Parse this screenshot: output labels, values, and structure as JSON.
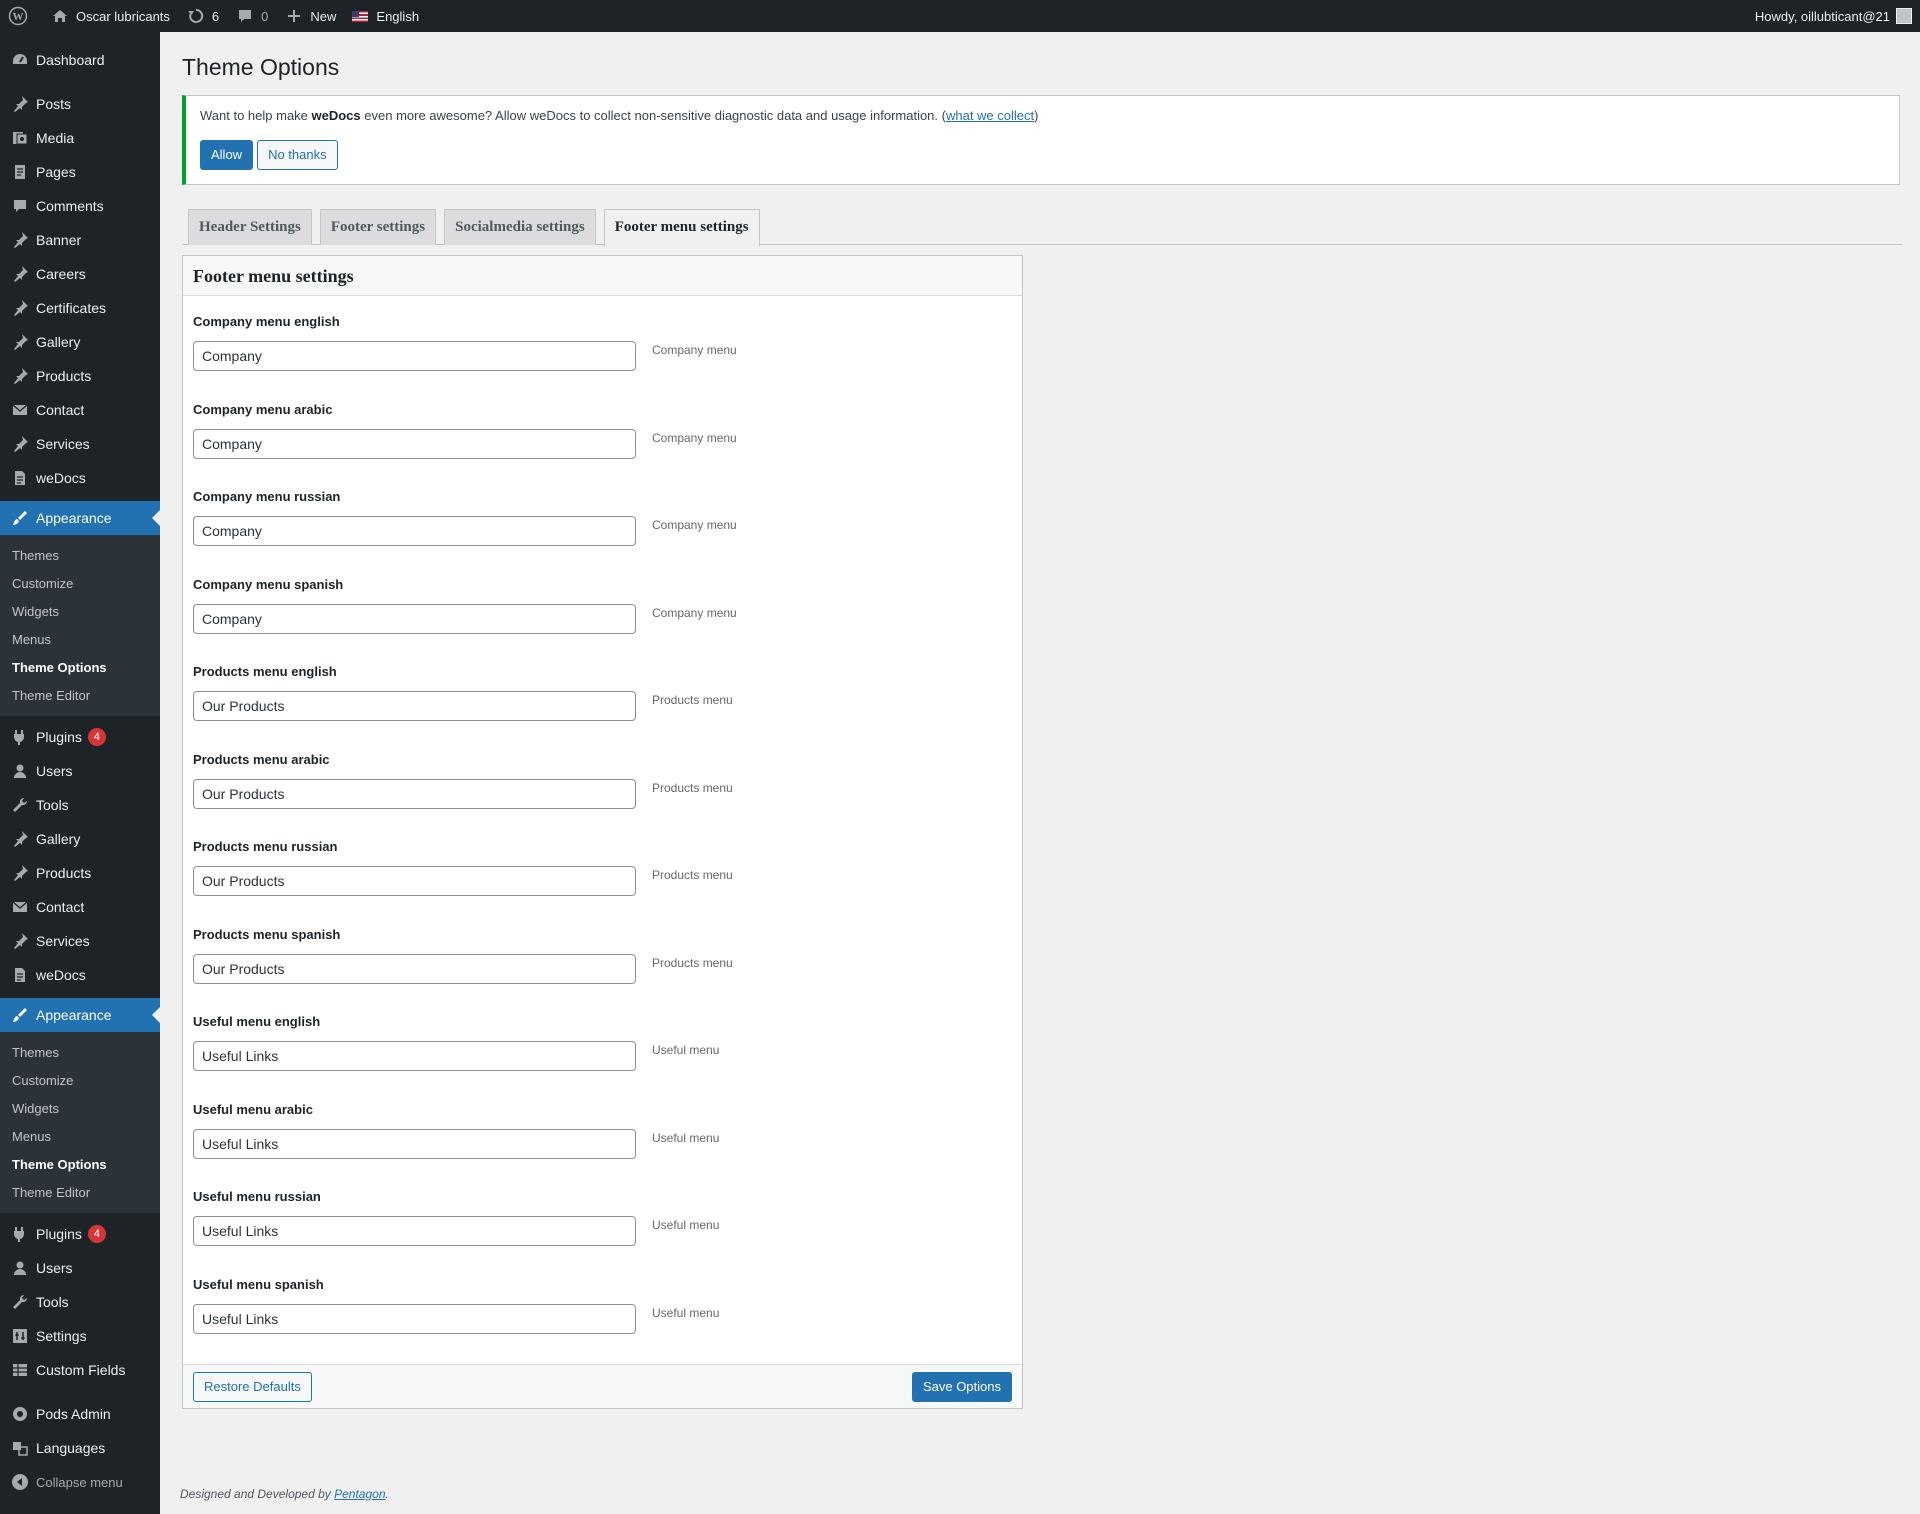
{
  "adminbar": {
    "site_name": "Oscar lubricants",
    "updates_count": "6",
    "comments_count": "0",
    "new_label": "New",
    "language": "English",
    "howdy": "Howdy, oillubticant@21"
  },
  "sidebar": {
    "top_items": [
      {
        "label": "Dashboard",
        "icon": "dashboard-icon"
      }
    ],
    "group1": [
      {
        "label": "Posts",
        "icon": "pin-icon"
      },
      {
        "label": "Media",
        "icon": "media-icon"
      },
      {
        "label": "Pages",
        "icon": "pages-icon"
      },
      {
        "label": "Comments",
        "icon": "comment-icon"
      },
      {
        "label": "Banner",
        "icon": "pin-icon"
      },
      {
        "label": "Careers",
        "icon": "pin-icon"
      },
      {
        "label": "Certificates",
        "icon": "pin-icon"
      },
      {
        "label": "Gallery",
        "icon": "pin-icon"
      },
      {
        "label": "Products",
        "icon": "pin-icon"
      },
      {
        "label": "Contact",
        "icon": "mail-icon"
      },
      {
        "label": "Services",
        "icon": "pin-icon"
      },
      {
        "label": "weDocs",
        "icon": "doc-icon"
      }
    ],
    "appearance_label": "Appearance",
    "appearance_sub": [
      "Themes",
      "Customize",
      "Widgets",
      "Menus",
      "Theme Options",
      "Theme Editor"
    ],
    "plugins_label": "Plugins",
    "plugins_badge": "4",
    "group2": [
      {
        "label": "Users",
        "icon": "user-icon"
      },
      {
        "label": "Tools",
        "icon": "wrench-icon"
      },
      {
        "label": "Gallery",
        "icon": "pin-icon"
      },
      {
        "label": "Products",
        "icon": "pin-icon"
      },
      {
        "label": "Contact",
        "icon": "mail-icon"
      },
      {
        "label": "Services",
        "icon": "pin-icon"
      },
      {
        "label": "weDocs",
        "icon": "doc-icon"
      }
    ],
    "group3": [
      {
        "label": "Users",
        "icon": "user-icon"
      },
      {
        "label": "Tools",
        "icon": "wrench-icon"
      },
      {
        "label": "Settings",
        "icon": "settings-icon"
      },
      {
        "label": "Custom Fields",
        "icon": "table-icon"
      }
    ],
    "pods_admin": "Pods Admin",
    "languages": "Languages",
    "collapse": "Collapse menu"
  },
  "page": {
    "title": "Theme Options"
  },
  "notice": {
    "text_before": "Want to help make ",
    "brand": "weDocs",
    "text_after": " even more awesome? Allow weDocs to collect non-sensitive diagnostic data and usage information. (",
    "link": "what we collect",
    "text_close": ")",
    "allow": "Allow",
    "no_thanks": "No thanks"
  },
  "tabs": [
    "Header Settings",
    "Footer settings",
    "Socialmedia settings",
    "Footer menu settings"
  ],
  "panel": {
    "title": "Footer menu settings",
    "fields": [
      {
        "label": "Company menu english",
        "value": "Company",
        "desc": "Company menu"
      },
      {
        "label": "Company menu arabic",
        "value": "Company",
        "desc": "Company menu"
      },
      {
        "label": "Company menu russian",
        "value": "Company",
        "desc": "Company menu"
      },
      {
        "label": "Company menu spanish",
        "value": "Company",
        "desc": "Company menu"
      },
      {
        "label": "Products menu english",
        "value": "Our Products",
        "desc": "Products menu"
      },
      {
        "label": "Products menu arabic",
        "value": "Our Products",
        "desc": "Products menu"
      },
      {
        "label": "Products menu russian",
        "value": "Our Products",
        "desc": "Products menu"
      },
      {
        "label": "Products menu spanish",
        "value": "Our Products",
        "desc": "Products menu"
      },
      {
        "label": "Useful menu english",
        "value": "Useful Links",
        "desc": "Useful menu"
      },
      {
        "label": "Useful menu arabic",
        "value": "Useful Links",
        "desc": "Useful menu"
      },
      {
        "label": "Useful menu russian",
        "value": "Useful Links",
        "desc": "Useful menu"
      },
      {
        "label": "Useful menu spanish",
        "value": "Useful Links",
        "desc": "Useful menu"
      }
    ],
    "restore": "Restore Defaults",
    "save": "Save Options"
  },
  "footer": {
    "text": "Designed and Developed by ",
    "link": "Pentagon",
    "end": "."
  },
  "colors": {
    "admin_dark": "#1d2327",
    "accent": "#2271b1",
    "notice_border": "#00a32a",
    "badge": "#d63638"
  }
}
